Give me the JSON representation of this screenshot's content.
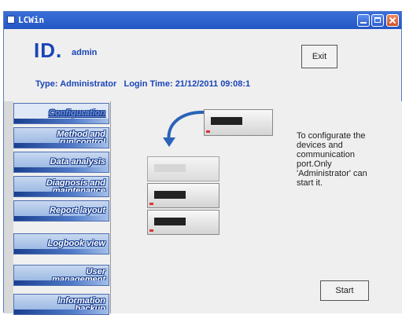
{
  "window": {
    "title": "LCWin"
  },
  "header": {
    "logo": "ID.",
    "username": "admin",
    "type_label": "Type:",
    "type_value": "Administrator",
    "login_label": "Login Time:",
    "login_value": "21/12/2011 09:08:1",
    "exit_label": "Exit"
  },
  "sidebar": {
    "items": [
      {
        "label": "Configuration",
        "active": true
      },
      {
        "label_line1": "Method and",
        "label_line2": "run control"
      },
      {
        "label": "Data analysis"
      },
      {
        "label_line1": "Diagnosis and",
        "label_line2": "maintenance"
      },
      {
        "label": "Report layout"
      },
      {
        "label": "Logbook view"
      },
      {
        "label_line1": "User",
        "label_line2": "management"
      },
      {
        "label_line1": "Information",
        "label_line2": "backup"
      }
    ]
  },
  "content": {
    "description": "To configurate the devices and communication port.Only 'Administrator' can start it.",
    "start_label": "Start"
  },
  "icons": [
    "window-icon",
    "minimize-icon",
    "maximize-icon",
    "close-icon",
    "curved-arrow-icon",
    "device-stack-icon"
  ]
}
